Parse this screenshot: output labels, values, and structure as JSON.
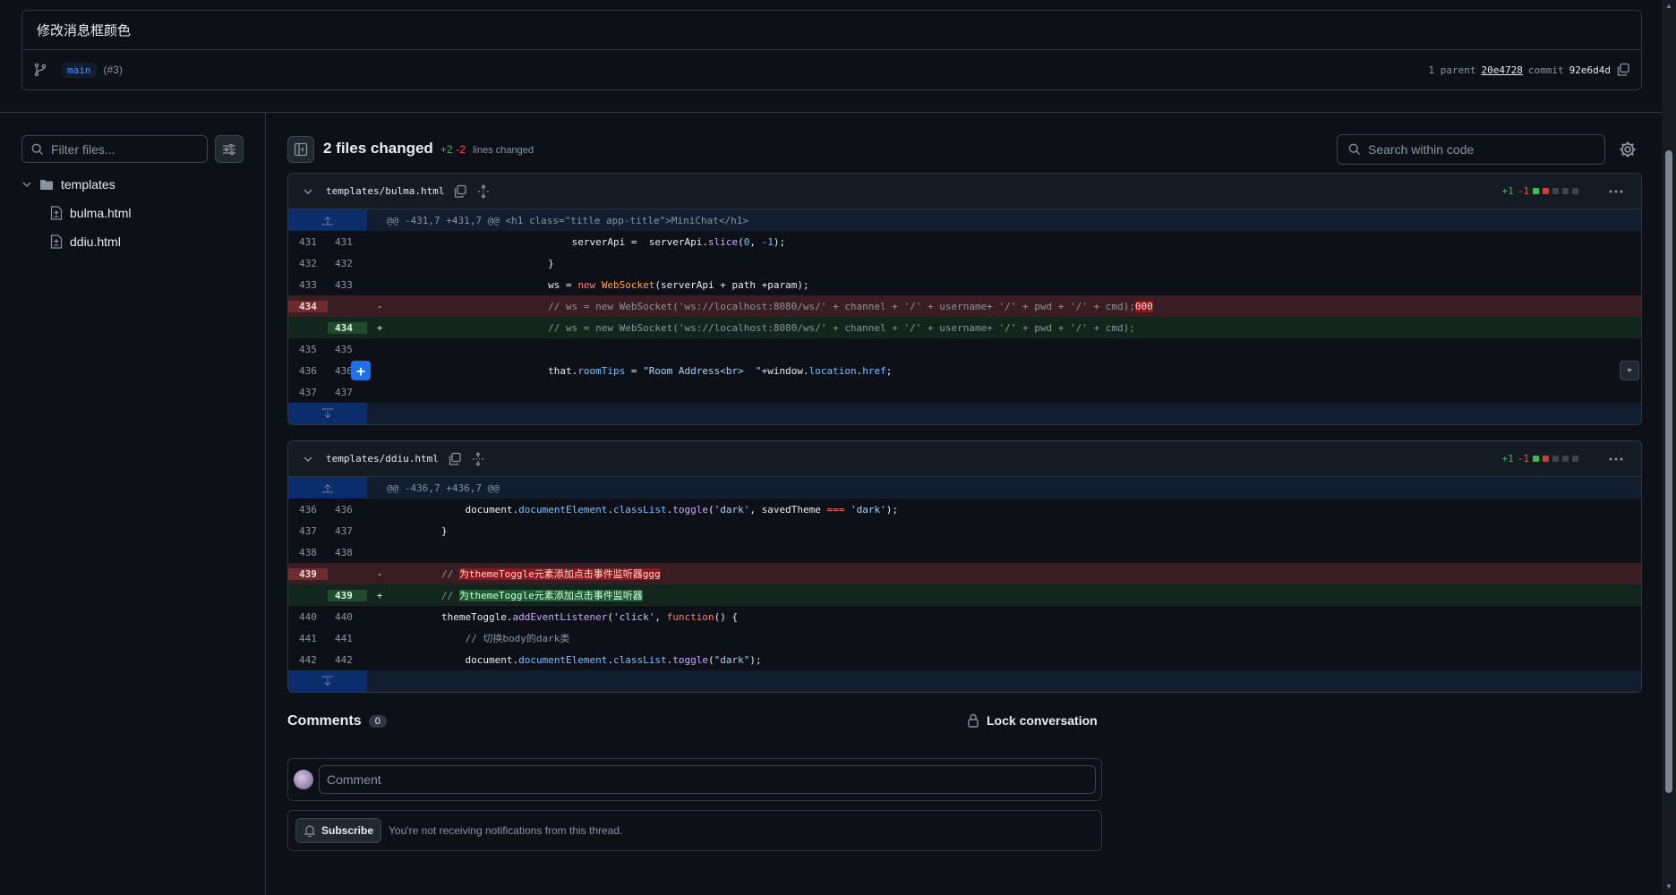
{
  "commit": {
    "title": "修改消息框颜色",
    "branch": "main",
    "pr": "(#3)",
    "parent_label": "1 parent",
    "parent_sha": "20e4728",
    "commit_label": "commit",
    "commit_sha": "92e6d4d"
  },
  "sidebar": {
    "filter_placeholder": "Filter files...",
    "folder": "templates",
    "files": [
      "bulma.html",
      "ddiu.html"
    ]
  },
  "toolbar": {
    "files_changed": "2 files changed",
    "additions": "+2",
    "deletions": "-2",
    "lines_changed_label": "lines changed",
    "search_placeholder": "Search within code"
  },
  "files": [
    {
      "name": "templates/bulma.html",
      "stat_add": "+1",
      "stat_del": "-1",
      "hunk": "@@ -431,7 +431,7 @@ <h1 class=\"title app-title\">MiniChat</h1>"
    },
    {
      "name": "templates/ddiu.html",
      "stat_add": "+1",
      "stat_del": "-1",
      "hunk": "@@ -436,7 +436,7 @@"
    }
  ],
  "comments": {
    "title": "Comments",
    "count": "0",
    "lock_label": "Lock conversation",
    "comment_placeholder": "Comment",
    "subscribe_label": "Subscribe",
    "subscribe_note": "You're not receiving notifications from this thread."
  },
  "colors": {
    "background": "#0d1117",
    "addition": "#3fb950",
    "deletion": "#f85149",
    "accent": "#1f6feb"
  }
}
